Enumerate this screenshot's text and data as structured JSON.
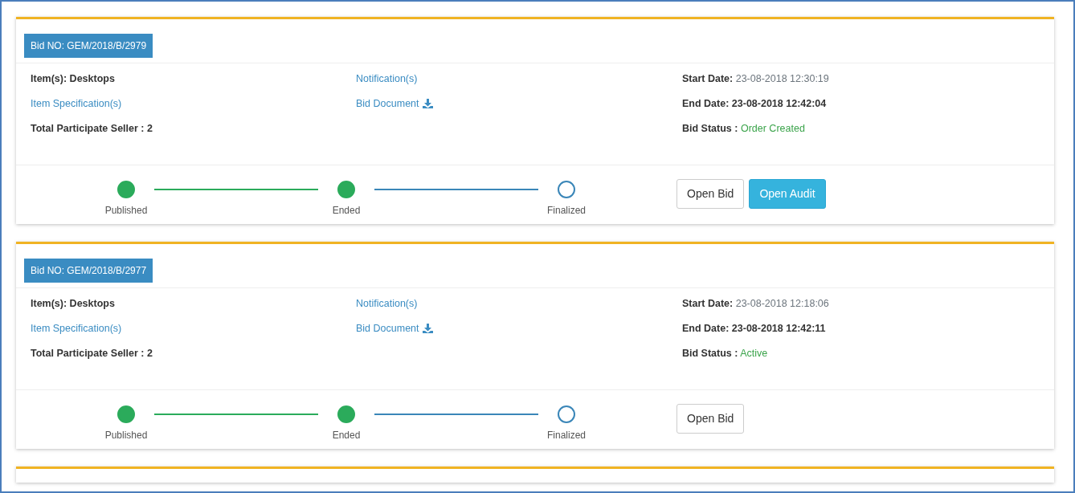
{
  "bids": [
    {
      "bid_no": "Bid NO: GEM/2018/B/2979",
      "items_label": "Item(s):",
      "items": "Desktops",
      "spec_link": "Item Specification(s)",
      "sellers": "Total Participate Seller : 2",
      "notifications_link": "Notification(s)",
      "document_link": "Bid Document",
      "start_label": "Start Date:",
      "start_date": "23-08-2018 12:30:19",
      "end_label": "End Date:",
      "end_date": "23-08-2018 12:42:04",
      "status_label": "Bid Status :",
      "status": "Order Created",
      "stages": [
        {
          "label": "Published",
          "done": true
        },
        {
          "label": "Ended",
          "done": true
        },
        {
          "label": "Finalized",
          "done": false
        }
      ],
      "buttons": [
        {
          "label": "Open Bid",
          "kind": "default"
        },
        {
          "label": "Open Audit",
          "kind": "primary"
        }
      ]
    },
    {
      "bid_no": "Bid NO: GEM/2018/B/2977",
      "items_label": "Item(s):",
      "items": "Desktops",
      "spec_link": "Item Specification(s)",
      "sellers": "Total Participate Seller : 2",
      "notifications_link": "Notification(s)",
      "document_link": "Bid Document",
      "start_label": "Start Date:",
      "start_date": "23-08-2018 12:18:06",
      "end_label": "End Date:",
      "end_date": "23-08-2018 12:42:11",
      "status_label": "Bid Status :",
      "status": "Active",
      "stages": [
        {
          "label": "Published",
          "done": true
        },
        {
          "label": "Ended",
          "done": true
        },
        {
          "label": "Finalized",
          "done": false
        }
      ],
      "buttons": [
        {
          "label": "Open Bid",
          "kind": "default"
        }
      ]
    }
  ]
}
